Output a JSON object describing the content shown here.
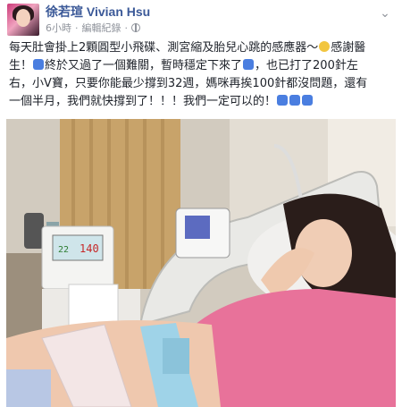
{
  "header": {
    "name": "徐若瑄 Vivian Hsu",
    "time": "6小時",
    "edited": "編輯紀錄"
  },
  "post": {
    "line1": "每天肚會掛上2顆圓型小飛碟、測宮縮及胎兒心跳的感應器～",
    "line1b": "感謝醫",
    "line2": "生！",
    "line2b": "終於又過了一個難關，暫時穩定下來了",
    "line2c": "，也已打了200針左",
    "line3": "右，小V寶，只要你能最少撐到32週，媽咪再挨100針都沒問題，還有",
    "line4": "一個半月，我們就快撐到了！！！我們一定可以的！"
  },
  "photo": {
    "monitor_reading_left": "140",
    "monitor_reading_right": "22"
  },
  "colors": {
    "name_blue": "#3b5998",
    "meta_gray": "#90949c"
  },
  "icons": [
    "globe-icon",
    "chevron-down-icon",
    "smile-emoji",
    "thumbs-up-emoji"
  ]
}
